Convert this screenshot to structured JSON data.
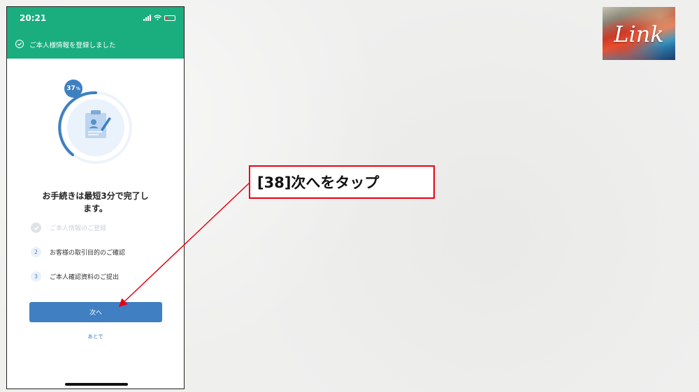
{
  "phone": {
    "status_time": "20:21",
    "banner_text": "ご本人様情報を登録しました",
    "progress_percent": 37,
    "progress_symbol": "%",
    "title_line1": "お手続きは最短3分で完了し",
    "title_line2": "ます。",
    "steps": [
      {
        "num": "",
        "label": "ご本人情報のご登録",
        "done": true
      },
      {
        "num": "2",
        "label": "お客様の取引目的のご確認",
        "done": false
      },
      {
        "num": "3",
        "label": "ご本人確認資料のご提出",
        "done": false
      }
    ],
    "next_button": "次へ",
    "later_link": "あとで"
  },
  "callout": {
    "text": "[38]次へをタップ"
  },
  "logo": {
    "text": "Link"
  },
  "colors": {
    "accent_green": "#1aae7f",
    "accent_blue": "#3f7fc2",
    "callout_red": "#e60012"
  }
}
